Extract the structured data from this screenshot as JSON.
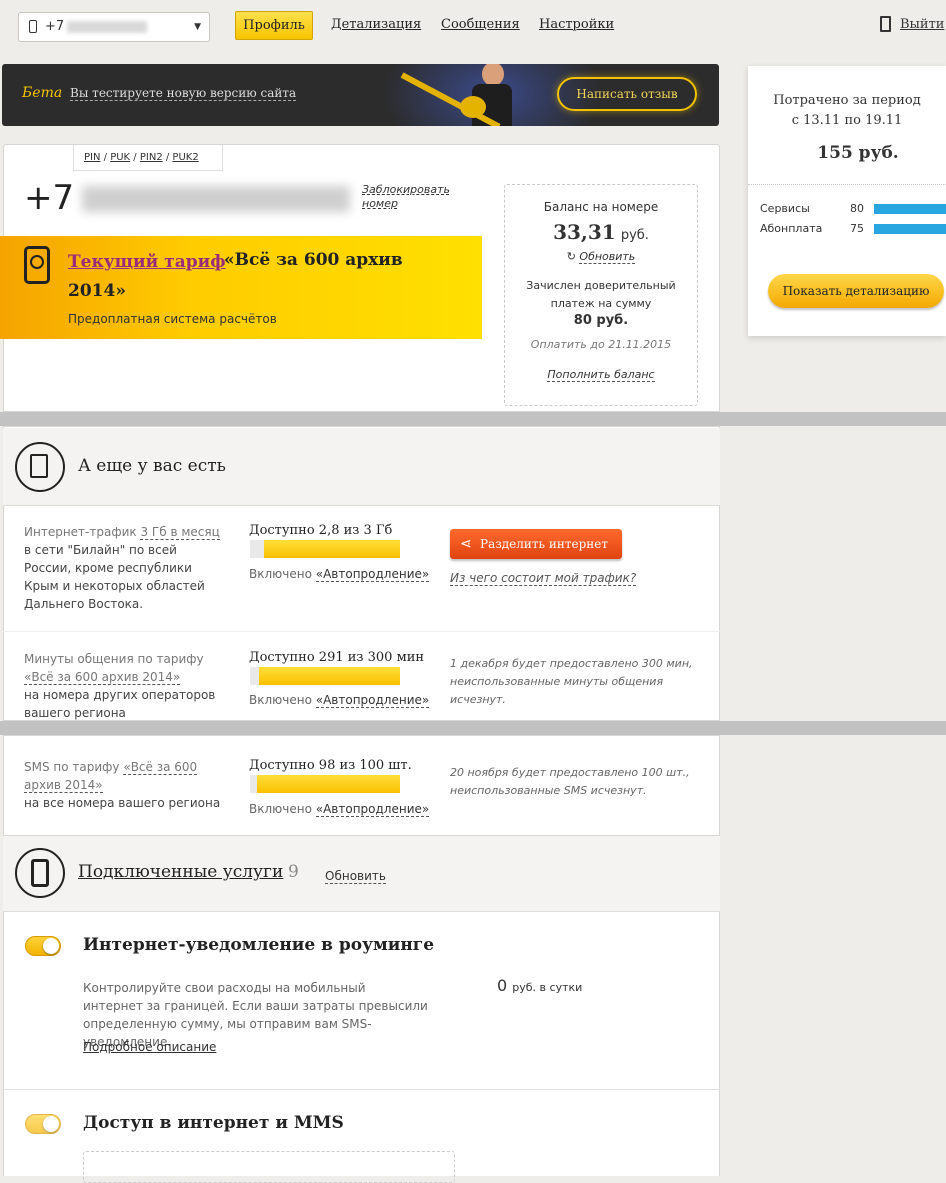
{
  "header": {
    "phone_prefix": "+7",
    "nav": [
      "Профиль",
      "Детализация",
      "Сообщения",
      "Настройки"
    ],
    "logout": "Выйти"
  },
  "beta": {
    "badge": "Бета",
    "text": "Вы тестируете новую версию сайта",
    "button": "Написать отзыв"
  },
  "summary": {
    "title_line1": "Потрачено за период",
    "title_line2": "с 13.11 по 19.11",
    "total": "155 руб.",
    "rows": [
      {
        "label": "Сервисы",
        "value": "80"
      },
      {
        "label": "Абонплата",
        "value": "75"
      }
    ],
    "button": "Показать детализацию"
  },
  "profile": {
    "codes": [
      "PIN",
      "PUK",
      "PIN2",
      "PUK2"
    ],
    "number_prefix": "+7",
    "block_link": "Заблокировать номер",
    "tariff_link": "Текущий тариф",
    "tariff_name": "«Всё за 600 архив 2014»",
    "tariff_sub": "Предоплатная система расчётов"
  },
  "balance": {
    "label": "Баланс на номере",
    "amount": "33,31",
    "currency": "руб.",
    "refresh": "Обновить",
    "trust_text": "Зачислен доверительный платеж на сумму",
    "trust_amount": "80 руб.",
    "pay_until": "Оплатить до 21.11.2015",
    "topup": "Пополнить баланс"
  },
  "extras": {
    "title": "А еще у вас есть",
    "items": [
      {
        "label": "Интернет-трафик",
        "label_link": "3 Гб в месяц",
        "desc": "в сети \"Билайн\" по всей России, кроме республики Крым и некоторых областей Дальнего Востока.",
        "available": "Доступно 2,8 из 3 Гб",
        "fill": 0.93,
        "included": "Включено",
        "included_link": "«Автопродление»",
        "button": "Разделить интернет",
        "side_link": "Из чего состоит мой трафик?"
      },
      {
        "label": "Минуты общения по тарифу",
        "label_link": "«Всё за 600 архив 2014»",
        "desc": "на номера других операторов вашего региона",
        "available": "Доступно 291 из 300 мин",
        "fill": 0.97,
        "included": "Включено",
        "included_link": "«Автопродление»",
        "note": "1 декабря будет предоставлено 300 мин, неиспользованные минуты общения исчезнут."
      },
      {
        "label": "SMS по тарифу",
        "label_link": "«Всё за 600 архив 2014»",
        "desc": "на все номера вашего региона",
        "available": "Доступно 98 из 100 шт.",
        "fill": 0.98,
        "included": "Включено",
        "included_link": "«Автопродление»",
        "note": "20 ноября будет предоставлено 100 шт., неиспользованные SMS исчезнут."
      }
    ]
  },
  "services": {
    "title": "Подключенные услуги",
    "count": "9",
    "refresh": "Обновить",
    "items": [
      {
        "title": "Интернет-уведомление в роуминге",
        "desc": "Контролируйте свои расходы на мобильный интернет за границей. Если ваши затраты превысили определенную сумму, мы отправим вам SMS-уведомление.",
        "price": "0",
        "price_unit": "руб. в сутки",
        "more": "Подробное описание",
        "enabled": true
      },
      {
        "title": "Доступ в интернет и MMS",
        "enabled": true
      }
    ]
  },
  "colors": {
    "accent": "#ffcc00",
    "bar": "#29a6df",
    "share_button": "#ee5522"
  }
}
